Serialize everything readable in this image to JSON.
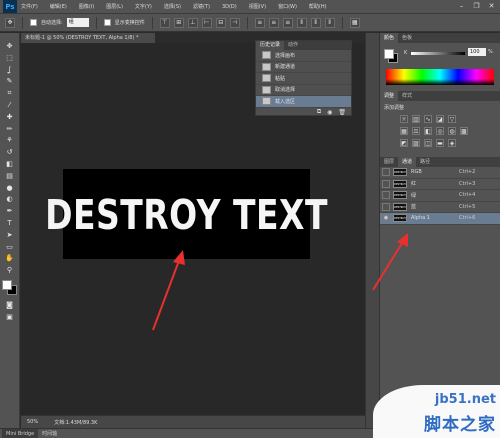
{
  "app": {
    "logo": "Ps"
  },
  "menu": [
    "文件(F)",
    "编辑(E)",
    "图像(I)",
    "图层(L)",
    "文字(Y)",
    "选择(S)",
    "滤镜(T)",
    "3D(D)",
    "视图(V)",
    "窗口(W)",
    "帮助(H)"
  ],
  "window_controls": [
    "minimize-icon",
    "restore-icon",
    "close-icon"
  ],
  "options": {
    "auto_select_label": "自动选择:",
    "auto_select_value": "组",
    "show_transform_label": "显示变换控件"
  },
  "tools": [
    "move-icon",
    "marquee-icon",
    "lasso-icon",
    "quick-select-icon",
    "crop-icon",
    "eyedropper-icon",
    "healing-icon",
    "brush-icon",
    "clone-stamp-icon",
    "history-brush-icon",
    "eraser-icon",
    "gradient-icon",
    "blur-icon",
    "dodge-icon",
    "pen-icon",
    "type-icon",
    "path-select-icon",
    "rectangle-icon",
    "hand-icon",
    "zoom-icon"
  ],
  "tool_glyphs": [
    "✥",
    "⬚",
    "ʆ",
    "✎",
    "⌗",
    "⁄",
    "✚",
    "✏",
    "⚘",
    "↺",
    "◧",
    "▤",
    "●",
    "◐",
    "✒",
    "T",
    "➤",
    "▭",
    "✋",
    "⚲"
  ],
  "document": {
    "tab_title": "未标题-1 @ 50% (DESTROY TEXT, Alpha 1/8) *",
    "art_text": "DESTROY  TEXT"
  },
  "history": {
    "tabs": [
      "历史记录",
      "动作"
    ],
    "items": [
      "选择画布",
      "新建通道",
      "粘贴",
      "取消选择",
      "载入选区"
    ],
    "selected_index": 4
  },
  "color": {
    "tabs": [
      "颜色",
      "色板"
    ],
    "channel": "K",
    "value": "100",
    "unit": "%"
  },
  "adjustments": {
    "tabs": [
      "调整",
      "样式"
    ],
    "title": "添加调整"
  },
  "channels": {
    "tabs": [
      "图层",
      "通道",
      "路径"
    ],
    "rows": [
      {
        "name": "RGB",
        "shortcut": "Ctrl+2",
        "thumb": "DESTROY"
      },
      {
        "name": "红",
        "shortcut": "Ctrl+3",
        "thumb": "DESTROY"
      },
      {
        "name": "绿",
        "shortcut": "Ctrl+4",
        "thumb": "DESTROY"
      },
      {
        "name": "蓝",
        "shortcut": "Ctrl+5",
        "thumb": "DESTROY"
      },
      {
        "name": "Alpha 1",
        "shortcut": "Ctrl+6",
        "thumb": "DESTROY"
      }
    ],
    "selected_index": 4
  },
  "status": {
    "zoom": "50%",
    "doc_size": "文档:1.43M/89.3K"
  },
  "bottom": {
    "mini_bridge": "Mini Bridge",
    "timeline": "时间轴"
  },
  "watermark": {
    "url": "jb51.net",
    "cn": "脚本之家"
  },
  "colors": {
    "accent": "#6a7c92",
    "arrow": "#e8312f",
    "watermark_blue": "#3a72c4"
  }
}
